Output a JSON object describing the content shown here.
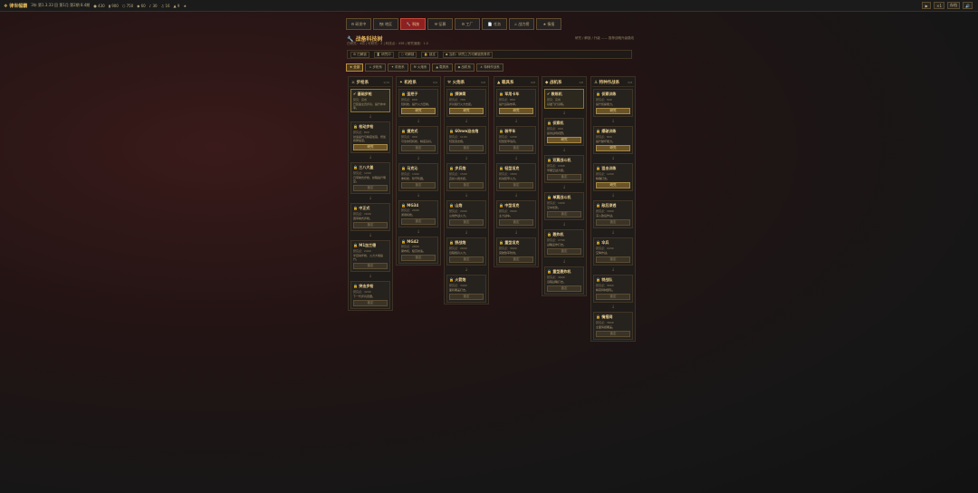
{
  "topbar": {
    "brand": "❖ 律世幅霸",
    "stats": [
      "3年 第1.3.33 回 第1月 第2期 8.4期",
      "● 430",
      "▮ 900",
      "⬡ 750",
      "◆ 60",
      "♪ 30",
      "♫ 16",
      "▲ 9",
      "★"
    ],
    "buttons": [
      "▶",
      "×1",
      "存档",
      "🔊"
    ]
  },
  "nav": {
    "tabs": [
      "⚙ 研发中",
      "🗺 地区",
      "🔧 科技",
      "⚒ 征募",
      "⚙ 工厂",
      "📄 任务",
      "⚔ 战力榜",
      "★ 情报"
    ]
  },
  "page": {
    "title": "🔧 战备科技树",
    "subtitle": "已研究：4项 | 可研究：2 | 科技点：436 | 研究速度：1.0",
    "right": "研究 / 解锁 / 升级 —— 推荐战略升级路线"
  },
  "infobar": {
    "items": [
      "⚙ 已解锁",
      "⏳ 研究中",
      "○ 可解锁",
      "🔒 锁定",
      "◆ 当前：研究上方可解锁的条件"
    ]
  },
  "filters": {
    "items": [
      "★ 全部",
      "⚔ 步枪系",
      "✦ 机枪系",
      "⚒ 火炮系",
      "▲ 载具系",
      "◆ 战机系",
      "⚓ 特种作战系"
    ]
  },
  "columns": [
    {
      "name": "⚔ 步枪系",
      "count": "1/10",
      "cards": [
        {
          "title": "✔ 基础步枪",
          "meta": "研究：完成",
          "desc": "已装备全员步兵，提升命中率。",
          "done": true,
          "btn": ""
        },
        {
          "title": "🔒 栓动步枪",
          "meta": "研究点：800",
          "desc": "射速提升与精度加强，增加换弹速度。",
          "done": false,
          "btn": "研究"
        },
        {
          "title": "🔒 三八大盖",
          "meta": "研究点：1200",
          "desc": "日军制式步枪，射程提升明显。",
          "done": false,
          "btn": "锁定"
        },
        {
          "title": "🔒 中正式",
          "meta": "研究点：1600",
          "desc": "国军制式步枪。",
          "done": false,
          "btn": "锁定"
        },
        {
          "title": "🔒 M1加兰德",
          "meta": "研究点：2400",
          "desc": "半自动步枪，火力大幅提升。",
          "done": false,
          "btn": "锁定"
        },
        {
          "title": "🔒 突击步枪",
          "meta": "研究点：3200",
          "desc": "下一代步兵武器。",
          "done": false,
          "btn": "锁定"
        }
      ]
    },
    {
      "name": "✦ 机枪系",
      "count": "0/9",
      "cards": [
        {
          "title": "🔒 歪把子",
          "meta": "研究点：600",
          "desc": "轻机枪，提升火力压制。",
          "done": false,
          "btn": "研究"
        },
        {
          "title": "🔒 捷克式",
          "meta": "研究点：900",
          "desc": "可靠的轻机枪，精度良好。",
          "done": false,
          "btn": "锁定"
        },
        {
          "title": "🔒 马克沁",
          "meta": "研究点：1400",
          "desc": "重机枪，防守利器。",
          "done": false,
          "btn": "锁定"
        },
        {
          "title": "🔒 MG34",
          "meta": "研究点：2000",
          "desc": "通用机枪。",
          "done": false,
          "btn": "锁定"
        },
        {
          "title": "🔒 MG42",
          "meta": "研究点：2800",
          "desc": "撕布机，极高射速。",
          "done": false,
          "btn": "锁定"
        }
      ]
    },
    {
      "name": "⚒ 火炮系",
      "count": "0/8",
      "cards": [
        {
          "title": "🔒 掷弹筒",
          "meta": "研究点：700",
          "desc": "步兵随行火力支援。",
          "done": false,
          "btn": "研究"
        },
        {
          "title": "🔒 60mm迫击炮",
          "meta": "研究点：1100",
          "desc": "轻型迫击炮。",
          "done": false,
          "btn": "锁定"
        },
        {
          "title": "🔒 步兵炮",
          "meta": "研究点：1500",
          "desc": "直射火炮支援。",
          "done": false,
          "btn": "锁定"
        },
        {
          "title": "🔒 山炮",
          "meta": "研究点：2000",
          "desc": "山地作战火力。",
          "done": false,
          "btn": "锁定"
        },
        {
          "title": "🔒 野战炮",
          "meta": "研究点：2600",
          "desc": "远程炮兵火力。",
          "done": false,
          "btn": "锁定"
        },
        {
          "title": "🔒 火箭炮",
          "meta": "研究点：3400",
          "desc": "面积覆盖打击。",
          "done": false,
          "btn": "锁定"
        }
      ]
    },
    {
      "name": "▲ 载具系",
      "count": "0/8",
      "cards": [
        {
          "title": "🔒 军用卡车",
          "meta": "研究点：800",
          "desc": "提升运输效率。",
          "done": false,
          "btn": "研究"
        },
        {
          "title": "🔒 装甲车",
          "meta": "研究点：1200",
          "desc": "轻型装甲载具。",
          "done": false,
          "btn": "锁定"
        },
        {
          "title": "🔒 轻型坦克",
          "meta": "研究点：1800",
          "desc": "机动装甲火力。",
          "done": false,
          "btn": "锁定"
        },
        {
          "title": "🔒 中型坦克",
          "meta": "研究点：2600",
          "desc": "主力战车。",
          "done": false,
          "btn": "锁定"
        },
        {
          "title": "🔒 重型坦克",
          "meta": "研究点：3600",
          "desc": "突破敌军防线。",
          "done": false,
          "btn": "锁定"
        }
      ]
    },
    {
      "name": "◆ 战机系",
      "count": "1/8",
      "cards": [
        {
          "title": "✔ 教练机",
          "meta": "研究：完成",
          "desc": "基础飞行训练。",
          "done": true,
          "btn": ""
        },
        {
          "title": "🔒 侦察机",
          "meta": "研究点：900",
          "desc": "提供战场视野。",
          "done": false,
          "btn": "研究"
        },
        {
          "title": "🔒 双翼战斗机",
          "meta": "研究点：1300",
          "desc": "早期空战力量。",
          "done": false,
          "btn": "锁定"
        },
        {
          "title": "🔒 单翼战斗机",
          "meta": "研究点：1900",
          "desc": "空中优势。",
          "done": false,
          "btn": "锁定"
        },
        {
          "title": "🔒 轰炸机",
          "meta": "研究点：2700",
          "desc": "战略轰炸打击。",
          "done": false,
          "btn": "锁定"
        },
        {
          "title": "🔒 重型轰炸机",
          "meta": "研究点：3600",
          "desc": "远程战略打击。",
          "done": false,
          "btn": "锁定"
        }
      ]
    },
    {
      "name": "⚓ 特种作战系",
      "count": "0/8",
      "cards": [
        {
          "title": "🔒 侦察训练",
          "meta": "研究点：500",
          "desc": "提升侦察能力。",
          "done": false,
          "btn": "研究"
        },
        {
          "title": "🔒 爆破训练",
          "meta": "研究点：800",
          "desc": "提升破坏能力。",
          "done": false,
          "btn": "研究"
        },
        {
          "title": "🔒 狙击训练",
          "meta": "研究点：1200",
          "desc": "精确打击。",
          "done": false,
          "btn": "研究"
        },
        {
          "title": "🔒 敌后渗透",
          "meta": "研究点：1600",
          "desc": "深入敌后作战。",
          "done": false,
          "btn": "锁定"
        },
        {
          "title": "🔒 伞兵",
          "meta": "研究点：2200",
          "desc": "空降作战。",
          "done": false,
          "btn": "锁定"
        },
        {
          "title": "🔒 特战队",
          "meta": "研究点：3000",
          "desc": "精英特种部队。",
          "done": false,
          "btn": "锁定"
        },
        {
          "title": "🔒 情报网",
          "meta": "研究点：3800",
          "desc": "全面情报覆盖。",
          "done": false,
          "btn": "锁定"
        }
      ]
    }
  ]
}
